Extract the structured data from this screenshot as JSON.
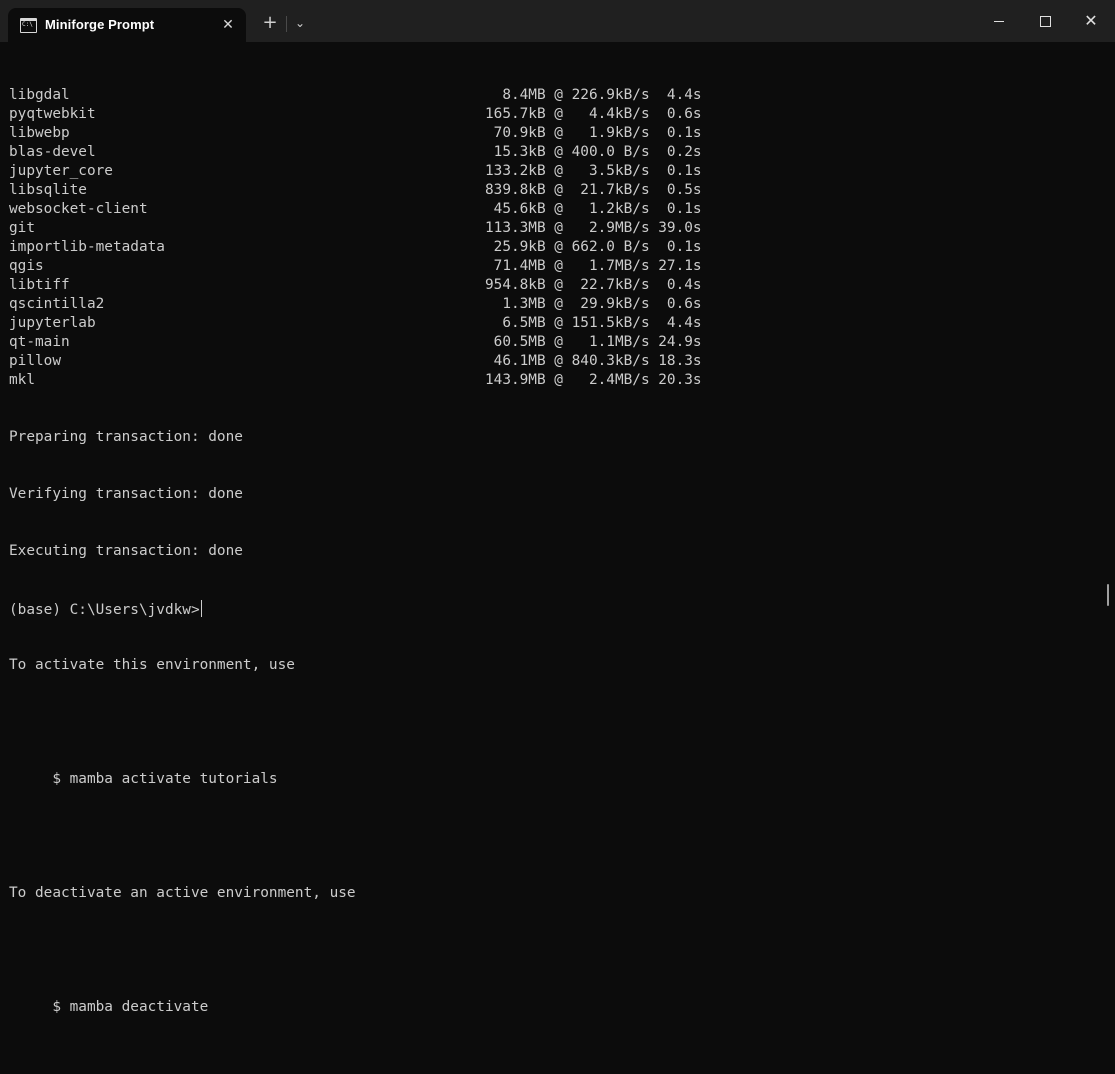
{
  "window": {
    "tab_title": "Miniforge Prompt",
    "tab_icon": "cmd-icon",
    "colors": {
      "titlebar": "#202020",
      "background": "#0c0c0c",
      "text": "#cccccc"
    }
  },
  "terminal": {
    "packages": [
      {
        "name": "libgdal",
        "stats": "     8.4MB @ 226.9kB/s  4.4s"
      },
      {
        "name": "pyqtwebkit",
        "stats": "   165.7kB @   4.4kB/s  0.6s"
      },
      {
        "name": "libwebp",
        "stats": "    70.9kB @   1.9kB/s  0.1s"
      },
      {
        "name": "blas-devel",
        "stats": "    15.3kB @ 400.0 B/s  0.2s"
      },
      {
        "name": "jupyter_core",
        "stats": "   133.2kB @   3.5kB/s  0.1s"
      },
      {
        "name": "libsqlite",
        "stats": "   839.8kB @  21.7kB/s  0.5s"
      },
      {
        "name": "websocket-client",
        "stats": "    45.6kB @   1.2kB/s  0.1s"
      },
      {
        "name": "git",
        "stats": "   113.3MB @   2.9MB/s 39.0s"
      },
      {
        "name": "importlib-metadata",
        "stats": "    25.9kB @ 662.0 B/s  0.1s"
      },
      {
        "name": "qgis",
        "stats": "    71.4MB @   1.7MB/s 27.1s"
      },
      {
        "name": "libtiff",
        "stats": "   954.8kB @  22.7kB/s  0.4s"
      },
      {
        "name": "qscintilla2",
        "stats": "     1.3MB @  29.9kB/s  0.6s"
      },
      {
        "name": "jupyterlab",
        "stats": "     6.5MB @ 151.5kB/s  4.4s"
      },
      {
        "name": "qt-main",
        "stats": "    60.5MB @   1.1MB/s 24.9s"
      },
      {
        "name": "pillow",
        "stats": "    46.1MB @ 840.3kB/s 18.3s"
      },
      {
        "name": "mkl",
        "stats": "   143.9MB @   2.4MB/s 20.3s"
      }
    ],
    "messages": {
      "preparing": "Preparing transaction: done",
      "verifying": "Verifying transaction: done",
      "executing": "Executing transaction: done",
      "activate_hint": "To activate this environment, use",
      "activate_cmd": "     $ mamba activate tutorials",
      "deactivate_hint": "To deactivate an active environment, use",
      "deactivate_cmd": "     $ mamba deactivate"
    },
    "prompt": "(base) C:\\Users\\jvdkw>"
  }
}
